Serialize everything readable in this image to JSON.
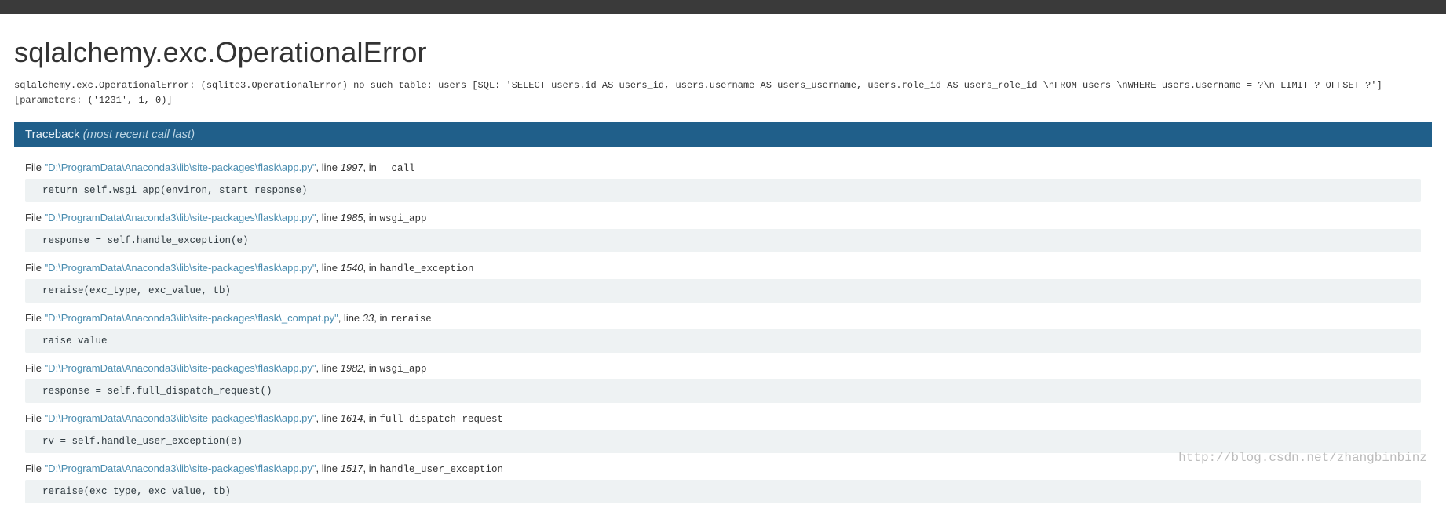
{
  "title": "sqlalchemy.exc.OperationalError",
  "description": "sqlalchemy.exc.OperationalError: (sqlite3.OperationalError) no such table: users [SQL: 'SELECT users.id AS users_id, users.username AS users_username, users.role_id AS users_role_id \\nFROM users \\nWHERE users.username = ?\\n LIMIT ? OFFSET ?'] [parameters: ('1231', 1, 0)]",
  "traceback_label": "Traceback ",
  "traceback_suffix": "(most recent call last)",
  "watermark": "http://blog.csdn.net/zhangbinbinz",
  "file_label": "File ",
  "line_label": ", line ",
  "in_label": ", in ",
  "frames": [
    {
      "path": "\"D:\\ProgramData\\Anaconda3\\lib\\site-packages\\flask\\app.py\"",
      "line": "1997",
      "func": "__call__",
      "code": "return self.wsgi_app(environ, start_response)"
    },
    {
      "path": "\"D:\\ProgramData\\Anaconda3\\lib\\site-packages\\flask\\app.py\"",
      "line": "1985",
      "func": "wsgi_app",
      "code": "response = self.handle_exception(e)"
    },
    {
      "path": "\"D:\\ProgramData\\Anaconda3\\lib\\site-packages\\flask\\app.py\"",
      "line": "1540",
      "func": "handle_exception",
      "code": "reraise(exc_type, exc_value, tb)"
    },
    {
      "path": "\"D:\\ProgramData\\Anaconda3\\lib\\site-packages\\flask\\_compat.py\"",
      "line": "33",
      "func": "reraise",
      "code": "raise value"
    },
    {
      "path": "\"D:\\ProgramData\\Anaconda3\\lib\\site-packages\\flask\\app.py\"",
      "line": "1982",
      "func": "wsgi_app",
      "code": "response = self.full_dispatch_request()"
    },
    {
      "path": "\"D:\\ProgramData\\Anaconda3\\lib\\site-packages\\flask\\app.py\"",
      "line": "1614",
      "func": "full_dispatch_request",
      "code": "rv = self.handle_user_exception(e)"
    },
    {
      "path": "\"D:\\ProgramData\\Anaconda3\\lib\\site-packages\\flask\\app.py\"",
      "line": "1517",
      "func": "handle_user_exception",
      "code": "reraise(exc_type, exc_value, tb)"
    }
  ]
}
